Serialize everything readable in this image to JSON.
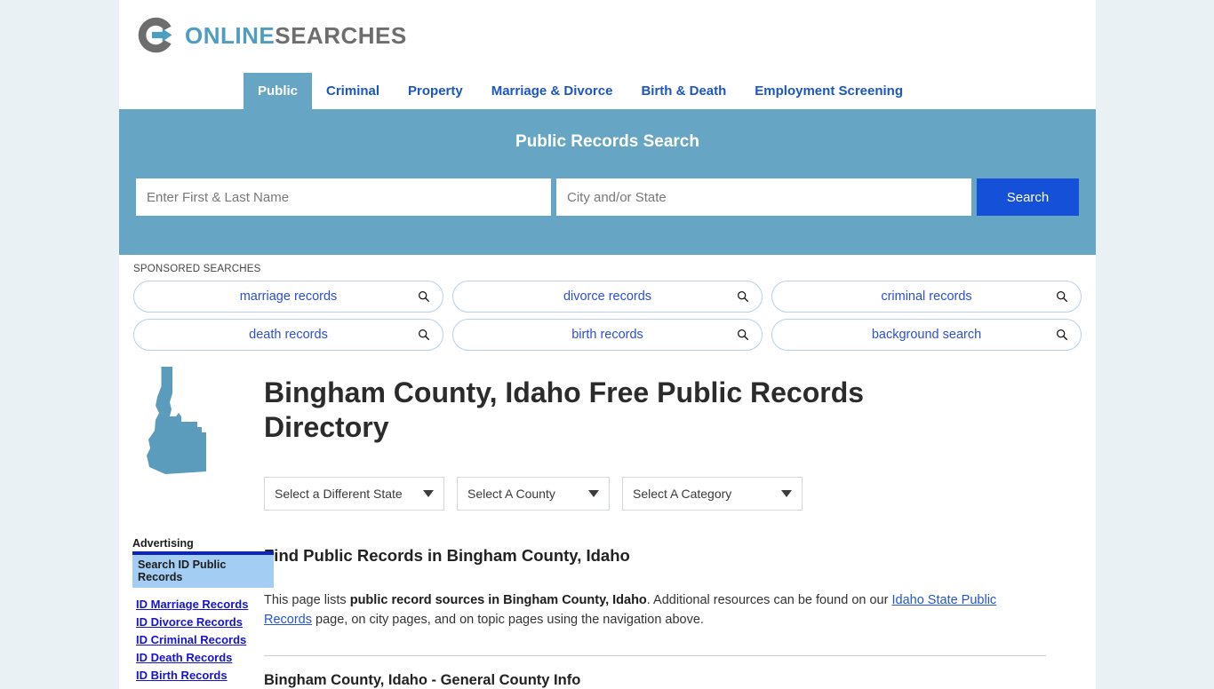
{
  "brand": {
    "name_part1": "ONLINE",
    "name_part2": "SEARCHES",
    "logo_icon": "circle-arrow-logo-icon",
    "blue": "#4f9dbf",
    "gray": "#6d6d6d"
  },
  "nav": {
    "items": [
      {
        "label": "Public",
        "active": true
      },
      {
        "label": "Criminal",
        "active": false
      },
      {
        "label": "Property",
        "active": false
      },
      {
        "label": "Marriage & Divorce",
        "active": false
      },
      {
        "label": "Birth & Death",
        "active": false
      },
      {
        "label": "Employment Screening",
        "active": false
      }
    ],
    "active_bg": "#66a6c4",
    "link_color": "#1b56c4"
  },
  "banner": {
    "title": "Public Records Search",
    "background": "#66a6c4",
    "name_placeholder": "Enter First & Last Name",
    "name_value": "",
    "city_placeholder": "City and/or State",
    "city_value": "",
    "search_label": "Search",
    "search_button_color": "#1550d8"
  },
  "sponsored": {
    "label": "SPONSORED SEARCHES",
    "pills": [
      "marriage records",
      "divorce records",
      "criminal records",
      "death records",
      "birth records",
      "background search"
    ]
  },
  "main": {
    "state_shape": "idaho-state-outline-icon",
    "state_color": "#5b9cbc",
    "page_title": "Bingham County, Idaho Free Public Records Directory",
    "selects": [
      {
        "value": "Select a Different State"
      },
      {
        "value": "Select A County"
      },
      {
        "value": "Select A Category"
      }
    ],
    "sub_title": "Find Public Records in Bingham County, Idaho",
    "paragraph": {
      "part1": "This page lists ",
      "bold": "public record sources in Bingham County, Idaho",
      "part2": ". Additional resources can be found on our ",
      "link": "Idaho State Public Records",
      "part3": " page, on city pages, and on topic pages using the navigation above."
    },
    "section_head": "Bingham County, Idaho - General County Info"
  },
  "sidebar": {
    "advertising_label": "Advertising",
    "box_header": "Search ID Public Records",
    "links": [
      "ID Marriage Records",
      "ID Divorce Records",
      "ID Criminal Records",
      "ID Death Records",
      "ID Birth Records"
    ]
  }
}
